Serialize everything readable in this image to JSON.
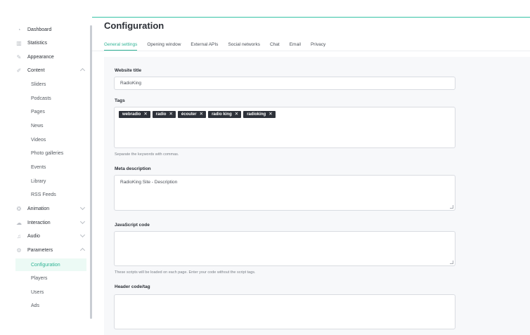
{
  "sidebar": {
    "items": [
      {
        "label": "Dashboard",
        "icon": "dashboard-icon"
      },
      {
        "label": "Statistics",
        "icon": "statistics-icon"
      },
      {
        "label": "Appearance",
        "icon": "appearance-icon"
      },
      {
        "label": "Content",
        "icon": "content-icon",
        "expanded": true
      },
      {
        "label": "Animation",
        "icon": "animation-icon",
        "expanded": false
      },
      {
        "label": "Interaction",
        "icon": "interaction-icon",
        "expanded": false
      },
      {
        "label": "Audio",
        "icon": "music-note-icon",
        "expanded": false
      },
      {
        "label": "Parameters",
        "icon": "gear-icon",
        "expanded": true
      }
    ],
    "content_sub": [
      "Sliders",
      "Podcasts",
      "Pages",
      "News",
      "Videos",
      "Photo galleries",
      "Events",
      "Library",
      "RSS Feeds"
    ],
    "parameters_sub": [
      "Configuration",
      "Players",
      "Users",
      "Ads"
    ],
    "active_sub": "Configuration"
  },
  "page": {
    "title": "Configuration",
    "tabs": [
      "General settings",
      "Opening window",
      "External APIs",
      "Social networks",
      "Chat",
      "Email",
      "Privacy"
    ],
    "active_tab": "General settings"
  },
  "form": {
    "website_title_label": "Website title",
    "website_title_value": "RadioKing",
    "tags_label": "Tags",
    "tags": [
      "webradio",
      "radio",
      "écouter",
      "radio king",
      "radioking"
    ],
    "tags_help": "Separate the keywords with commas.",
    "meta_label": "Meta description",
    "meta_value": "RadioKing Site - Description",
    "js_label": "JavaScript code",
    "js_value": "",
    "js_help": "These scripts will be loaded on each page. Enter your code without the script tags.",
    "header_label": "Header code/tag",
    "header_value": ""
  },
  "colors": {
    "accent": "#2fb395",
    "tag_bg": "#2e323a",
    "active_bg": "#ecfaf5"
  }
}
